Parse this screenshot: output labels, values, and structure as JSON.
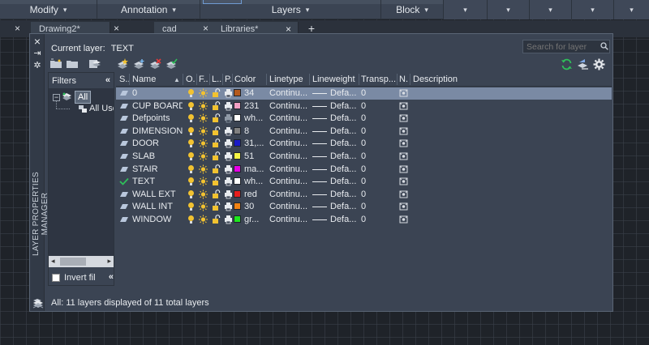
{
  "ribbon": {
    "panels": [
      {
        "label": "Modify",
        "arrow": "▾"
      },
      {
        "label": "Annotation",
        "arrow": "▾"
      },
      {
        "label": "Layers",
        "arrow": "▾"
      },
      {
        "label": "Block",
        "arrow": "▾"
      }
    ],
    "more_arrows": [
      "▾",
      "▾",
      "▾",
      "▾",
      "▾"
    ]
  },
  "tabs": [
    {
      "label": "Drawing2*",
      "close": "×"
    },
    {
      "label": "cad libraryyyyyyy*",
      "close": "×"
    },
    {
      "label": "Libraries*",
      "close": "×"
    }
  ],
  "tab_plus": "+",
  "palette": {
    "title": "LAYER PROPERTIES MANAGER",
    "close_glyph": "×",
    "pin_glyph": "⇥",
    "settings_glyph": "✲",
    "current_layer_label": "Current layer:",
    "current_layer_value": "TEXT",
    "search_placeholder": "Search for layer",
    "filters": {
      "header": "Filters",
      "collapse_glyph": "«",
      "tree_toggle": "−",
      "tree_all": "All",
      "tree_used": "All Used Layers",
      "scroll_left": "◂",
      "scroll_right": "▸",
      "invert_label": "Invert filter",
      "invert_collapse": "«"
    },
    "columns": [
      "S..",
      "Name",
      "O..",
      "F..",
      "L..",
      "P..",
      "Color",
      "Linetype",
      "Lineweight",
      "Transp...",
      "N..",
      "Description"
    ],
    "sort_arrow": "▲",
    "rows": [
      {
        "name": "0",
        "color_name": "34",
        "color": "#b45a1e",
        "linetype": "Continu...",
        "lineweight": "Defa...",
        "transparency": "0",
        "current": false,
        "selected": true
      },
      {
        "name": "CUP BOARD",
        "color_name": "231",
        "color": "#f29fc4",
        "linetype": "Continu...",
        "lineweight": "Defa...",
        "transparency": "0",
        "current": false,
        "selected": false
      },
      {
        "name": "Defpoints",
        "color_name": "wh...",
        "color": "#ffffff",
        "linetype": "Continu...",
        "lineweight": "Defa...",
        "transparency": "0",
        "current": false,
        "selected": false
      },
      {
        "name": "DIMENSION",
        "color_name": "8",
        "color": "#808080",
        "linetype": "Continu...",
        "lineweight": "Defa...",
        "transparency": "0",
        "current": false,
        "selected": false
      },
      {
        "name": "DOOR",
        "color_name": "31,...",
        "color": "#1a1ac8",
        "linetype": "Continu...",
        "lineweight": "Defa...",
        "transparency": "0",
        "current": false,
        "selected": false
      },
      {
        "name": "SLAB",
        "color_name": "51",
        "color": "#f5f546",
        "linetype": "Continu...",
        "lineweight": "Defa...",
        "transparency": "0",
        "current": false,
        "selected": false
      },
      {
        "name": "STAIR",
        "color_name": "ma...",
        "color": "#e600e6",
        "linetype": "Continu...",
        "lineweight": "Defa...",
        "transparency": "0",
        "current": false,
        "selected": false
      },
      {
        "name": "TEXT",
        "color_name": "wh...",
        "color": "#ffffff",
        "linetype": "Continu...",
        "lineweight": "Defa...",
        "transparency": "0",
        "current": true,
        "selected": false
      },
      {
        "name": "WALL EXT",
        "color_name": "red",
        "color": "#e61e1e",
        "linetype": "Continu...",
        "lineweight": "Defa...",
        "transparency": "0",
        "current": false,
        "selected": false
      },
      {
        "name": "WALL INT",
        "color_name": "30",
        "color": "#f08214",
        "linetype": "Continu...",
        "lineweight": "Defa...",
        "transparency": "0",
        "current": false,
        "selected": false
      },
      {
        "name": "WINDOW",
        "color_name": "gr...",
        "color": "#1ee61e",
        "linetype": "Continu...",
        "lineweight": "Defa...",
        "transparency": "0",
        "current": false,
        "selected": false
      }
    ],
    "status_text": "All: 11 layers displayed of 11 total layers",
    "colors": {
      "bulb": "#f2c230",
      "sun": "#f2c230",
      "lock": "#f2c230",
      "plot": "#e8ebef",
      "accent_refresh": "#2fc05a"
    }
  }
}
